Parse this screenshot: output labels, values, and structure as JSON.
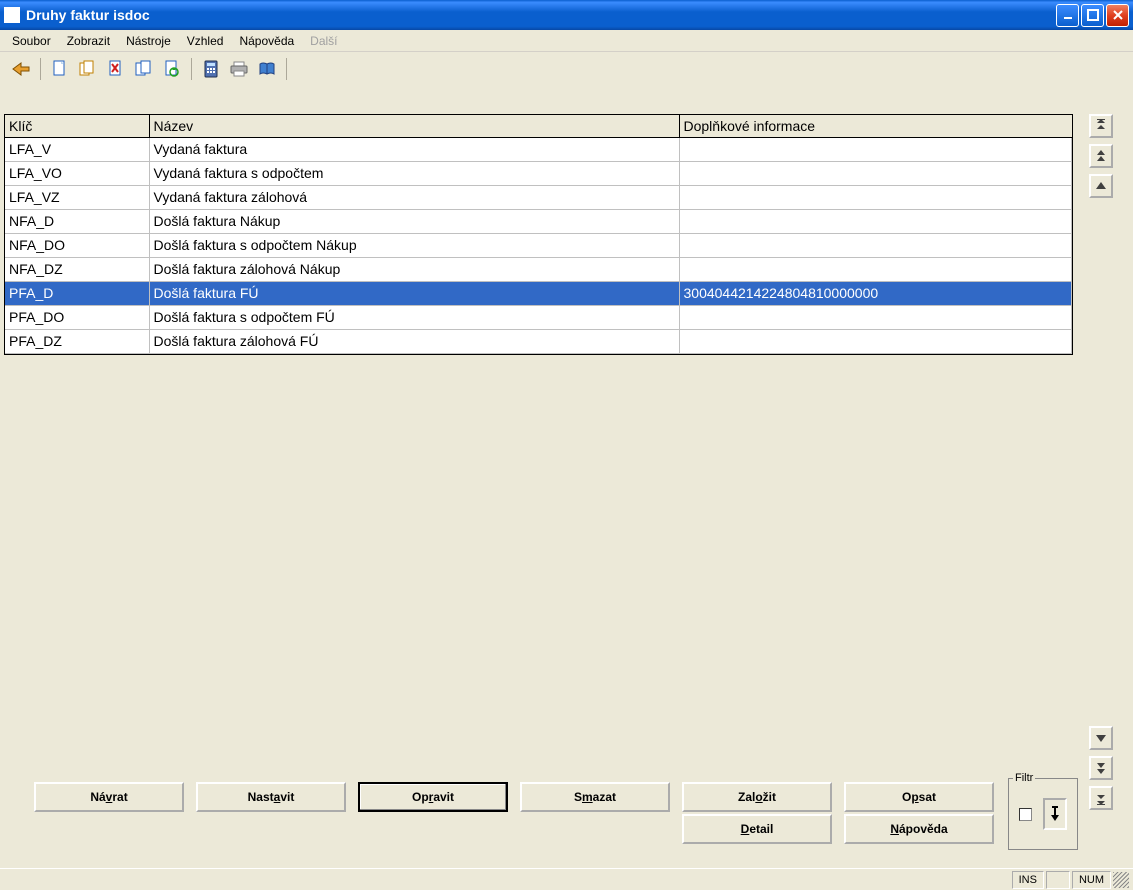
{
  "window": {
    "title": "Druhy faktur isdoc"
  },
  "menu": {
    "items": [
      {
        "label": "Soubor",
        "disabled": false
      },
      {
        "label": "Zobrazit",
        "disabled": false
      },
      {
        "label": "Nástroje",
        "disabled": false
      },
      {
        "label": "Vzhled",
        "disabled": false
      },
      {
        "label": "Nápověda",
        "disabled": false
      },
      {
        "label": "Další",
        "disabled": true
      }
    ]
  },
  "toolbar_icons": [
    "back",
    "doc-new",
    "doc-copy",
    "doc-delete",
    "doc-edit",
    "doc-refresh",
    "calc",
    "print",
    "book"
  ],
  "grid": {
    "columns": [
      "Klíč",
      "Název",
      "Doplňkové informace"
    ],
    "rows": [
      {
        "key": "LFA_V",
        "name": "Vydaná faktura",
        "info": "",
        "selected": false
      },
      {
        "key": "LFA_VO",
        "name": "Vydaná faktura s odpočtem",
        "info": "",
        "selected": false
      },
      {
        "key": "LFA_VZ",
        "name": "Vydaná faktura zálohová",
        "info": "",
        "selected": false
      },
      {
        "key": "NFA_D",
        "name": "Došlá faktura Nákup",
        "info": "",
        "selected": false
      },
      {
        "key": "NFA_DO",
        "name": "Došlá faktura s odpočtem Nákup",
        "info": "",
        "selected": false
      },
      {
        "key": "NFA_DZ",
        "name": "Došlá faktura zálohová Nákup",
        "info": "",
        "selected": false
      },
      {
        "key": "PFA_D",
        "name": "Došlá faktura FÚ",
        "info": "3004044214224804810000000",
        "selected": true
      },
      {
        "key": "PFA_DO",
        "name": "Došlá faktura s odpočtem FÚ",
        "info": "",
        "selected": false
      },
      {
        "key": "PFA_DZ",
        "name": "Došlá faktura zálohová FÚ",
        "info": "",
        "selected": false
      }
    ]
  },
  "buttons": {
    "navrat": {
      "pre": "Ná",
      "u": "v",
      "post": "rat"
    },
    "nastavit": {
      "pre": "Nast",
      "u": "a",
      "post": "vit"
    },
    "opravit": {
      "pre": "Op",
      "u": "r",
      "post": "avit"
    },
    "smazat": {
      "pre": "S",
      "u": "m",
      "post": "azat"
    },
    "zalozit": {
      "pre": "Zal",
      "u": "o",
      "post": "žit"
    },
    "opsat": {
      "pre": "O",
      "u": "p",
      "post": "sat"
    },
    "detail": {
      "pre": "",
      "u": "D",
      "post": "etail"
    },
    "napoveda": {
      "pre": "",
      "u": "N",
      "post": "ápověda"
    }
  },
  "filtr": {
    "label": "Filtr"
  },
  "status": {
    "ins": "INS",
    "num": "NUM"
  }
}
